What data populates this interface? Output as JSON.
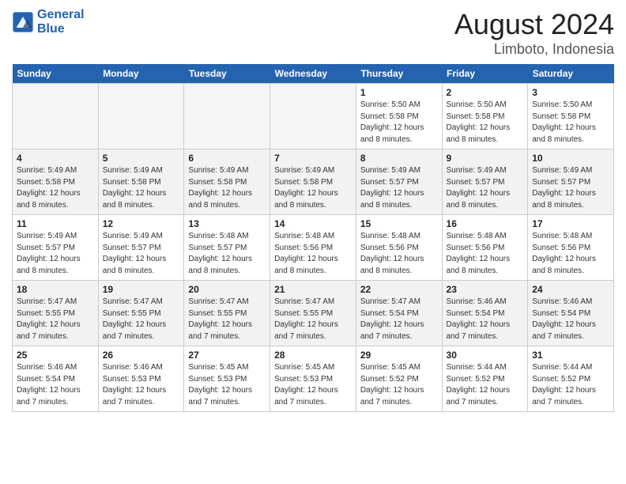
{
  "header": {
    "logo_line1": "General",
    "logo_line2": "Blue",
    "title": "August 2024",
    "subtitle": "Limboto, Indonesia"
  },
  "days_of_week": [
    "Sunday",
    "Monday",
    "Tuesday",
    "Wednesday",
    "Thursday",
    "Friday",
    "Saturday"
  ],
  "weeks": [
    [
      {
        "day": "",
        "info": ""
      },
      {
        "day": "",
        "info": ""
      },
      {
        "day": "",
        "info": ""
      },
      {
        "day": "",
        "info": ""
      },
      {
        "day": "1",
        "info": "Sunrise: 5:50 AM\nSunset: 5:58 PM\nDaylight: 12 hours and 8 minutes."
      },
      {
        "day": "2",
        "info": "Sunrise: 5:50 AM\nSunset: 5:58 PM\nDaylight: 12 hours and 8 minutes."
      },
      {
        "day": "3",
        "info": "Sunrise: 5:50 AM\nSunset: 5:58 PM\nDaylight: 12 hours and 8 minutes."
      }
    ],
    [
      {
        "day": "4",
        "info": "Sunrise: 5:49 AM\nSunset: 5:58 PM\nDaylight: 12 hours and 8 minutes."
      },
      {
        "day": "5",
        "info": "Sunrise: 5:49 AM\nSunset: 5:58 PM\nDaylight: 12 hours and 8 minutes."
      },
      {
        "day": "6",
        "info": "Sunrise: 5:49 AM\nSunset: 5:58 PM\nDaylight: 12 hours and 8 minutes."
      },
      {
        "day": "7",
        "info": "Sunrise: 5:49 AM\nSunset: 5:58 PM\nDaylight: 12 hours and 8 minutes."
      },
      {
        "day": "8",
        "info": "Sunrise: 5:49 AM\nSunset: 5:57 PM\nDaylight: 12 hours and 8 minutes."
      },
      {
        "day": "9",
        "info": "Sunrise: 5:49 AM\nSunset: 5:57 PM\nDaylight: 12 hours and 8 minutes."
      },
      {
        "day": "10",
        "info": "Sunrise: 5:49 AM\nSunset: 5:57 PM\nDaylight: 12 hours and 8 minutes."
      }
    ],
    [
      {
        "day": "11",
        "info": "Sunrise: 5:49 AM\nSunset: 5:57 PM\nDaylight: 12 hours and 8 minutes."
      },
      {
        "day": "12",
        "info": "Sunrise: 5:49 AM\nSunset: 5:57 PM\nDaylight: 12 hours and 8 minutes."
      },
      {
        "day": "13",
        "info": "Sunrise: 5:48 AM\nSunset: 5:57 PM\nDaylight: 12 hours and 8 minutes."
      },
      {
        "day": "14",
        "info": "Sunrise: 5:48 AM\nSunset: 5:56 PM\nDaylight: 12 hours and 8 minutes."
      },
      {
        "day": "15",
        "info": "Sunrise: 5:48 AM\nSunset: 5:56 PM\nDaylight: 12 hours and 8 minutes."
      },
      {
        "day": "16",
        "info": "Sunrise: 5:48 AM\nSunset: 5:56 PM\nDaylight: 12 hours and 8 minutes."
      },
      {
        "day": "17",
        "info": "Sunrise: 5:48 AM\nSunset: 5:56 PM\nDaylight: 12 hours and 8 minutes."
      }
    ],
    [
      {
        "day": "18",
        "info": "Sunrise: 5:47 AM\nSunset: 5:55 PM\nDaylight: 12 hours and 7 minutes."
      },
      {
        "day": "19",
        "info": "Sunrise: 5:47 AM\nSunset: 5:55 PM\nDaylight: 12 hours and 7 minutes."
      },
      {
        "day": "20",
        "info": "Sunrise: 5:47 AM\nSunset: 5:55 PM\nDaylight: 12 hours and 7 minutes."
      },
      {
        "day": "21",
        "info": "Sunrise: 5:47 AM\nSunset: 5:55 PM\nDaylight: 12 hours and 7 minutes."
      },
      {
        "day": "22",
        "info": "Sunrise: 5:47 AM\nSunset: 5:54 PM\nDaylight: 12 hours and 7 minutes."
      },
      {
        "day": "23",
        "info": "Sunrise: 5:46 AM\nSunset: 5:54 PM\nDaylight: 12 hours and 7 minutes."
      },
      {
        "day": "24",
        "info": "Sunrise: 5:46 AM\nSunset: 5:54 PM\nDaylight: 12 hours and 7 minutes."
      }
    ],
    [
      {
        "day": "25",
        "info": "Sunrise: 5:46 AM\nSunset: 5:54 PM\nDaylight: 12 hours and 7 minutes."
      },
      {
        "day": "26",
        "info": "Sunrise: 5:46 AM\nSunset: 5:53 PM\nDaylight: 12 hours and 7 minutes."
      },
      {
        "day": "27",
        "info": "Sunrise: 5:45 AM\nSunset: 5:53 PM\nDaylight: 12 hours and 7 minutes."
      },
      {
        "day": "28",
        "info": "Sunrise: 5:45 AM\nSunset: 5:53 PM\nDaylight: 12 hours and 7 minutes."
      },
      {
        "day": "29",
        "info": "Sunrise: 5:45 AM\nSunset: 5:52 PM\nDaylight: 12 hours and 7 minutes."
      },
      {
        "day": "30",
        "info": "Sunrise: 5:44 AM\nSunset: 5:52 PM\nDaylight: 12 hours and 7 minutes."
      },
      {
        "day": "31",
        "info": "Sunrise: 5:44 AM\nSunset: 5:52 PM\nDaylight: 12 hours and 7 minutes."
      }
    ]
  ]
}
